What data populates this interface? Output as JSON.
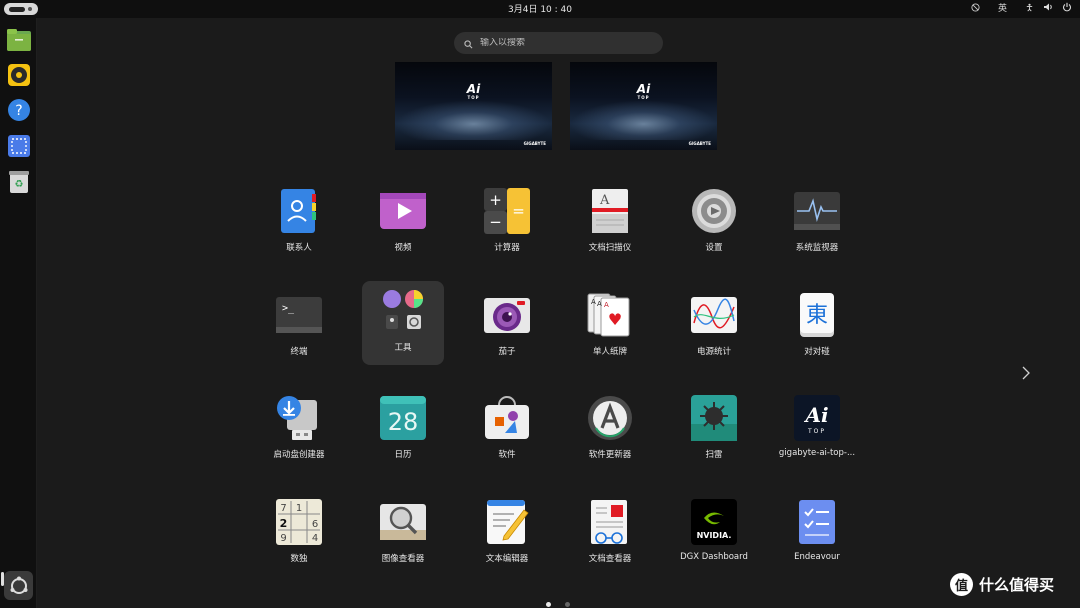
{
  "topbar": {
    "clock": "3月4日  10 : 40",
    "input_method": "英"
  },
  "dock": {
    "items": [
      "files-icon",
      "rhythmbox-icon",
      "help-icon",
      "screenshot-icon",
      "trash-icon"
    ],
    "apps_grid_icon": "ubuntu-apps-icon"
  },
  "search": {
    "placeholder": "输入以搜索"
  },
  "workspaces": [
    {
      "logo_text": "Ai",
      "logo_sub": "TOP",
      "brand": "GIGABYTE"
    },
    {
      "logo_text": "Ai",
      "logo_sub": "TOP",
      "brand": "GIGABYTE"
    }
  ],
  "apps": [
    {
      "label": "联系人",
      "icon": "contacts-icon"
    },
    {
      "label": "视频",
      "icon": "videos-icon"
    },
    {
      "label": "计算器",
      "icon": "calculator-icon"
    },
    {
      "label": "文档扫描仪",
      "icon": "document-scanner-icon"
    },
    {
      "label": "设置",
      "icon": "settings-icon"
    },
    {
      "label": "系统监视器",
      "icon": "system-monitor-icon"
    },
    {
      "label": "终端",
      "icon": "terminal-icon"
    },
    {
      "label": "工具",
      "icon": "utilities-folder-icon"
    },
    {
      "label": "茄子",
      "icon": "cheese-icon"
    },
    {
      "label": "单人纸牌",
      "icon": "solitaire-icon"
    },
    {
      "label": "电源统计",
      "icon": "power-statistics-icon"
    },
    {
      "label": "对对碰",
      "icon": "mahjongg-icon"
    },
    {
      "label": "启动盘创建器",
      "icon": "startup-disk-creator-icon"
    },
    {
      "label": "日历",
      "icon": "calendar-icon"
    },
    {
      "label": "软件",
      "icon": "software-icon"
    },
    {
      "label": "软件更新器",
      "icon": "software-updater-icon"
    },
    {
      "label": "扫雷",
      "icon": "mines-icon"
    },
    {
      "label": "gigabyte-ai-top-...",
      "icon": "gigabyte-ai-top-icon"
    },
    {
      "label": "数独",
      "icon": "sudoku-icon"
    },
    {
      "label": "图像查看器",
      "icon": "image-viewer-icon"
    },
    {
      "label": "文本编辑器",
      "icon": "text-editor-icon"
    },
    {
      "label": "文档查看器",
      "icon": "document-viewer-icon"
    },
    {
      "label": "DGX Dashboard",
      "icon": "nvidia-icon"
    },
    {
      "label": "Endeavour",
      "icon": "endeavour-icon"
    }
  ],
  "calendar_day": "28",
  "mahjongg_char": "東",
  "sudoku_digits": [
    "7",
    "1",
    "2",
    "6",
    "9",
    "4"
  ],
  "nvidia_text": "NVIDIA.",
  "terminal_prompt": ">_",
  "calc_symbols": [
    "+",
    "−",
    "="
  ],
  "pager": {
    "pages": 2,
    "current": 1
  },
  "watermark": {
    "text": "什么值得买",
    "logo": "值"
  }
}
